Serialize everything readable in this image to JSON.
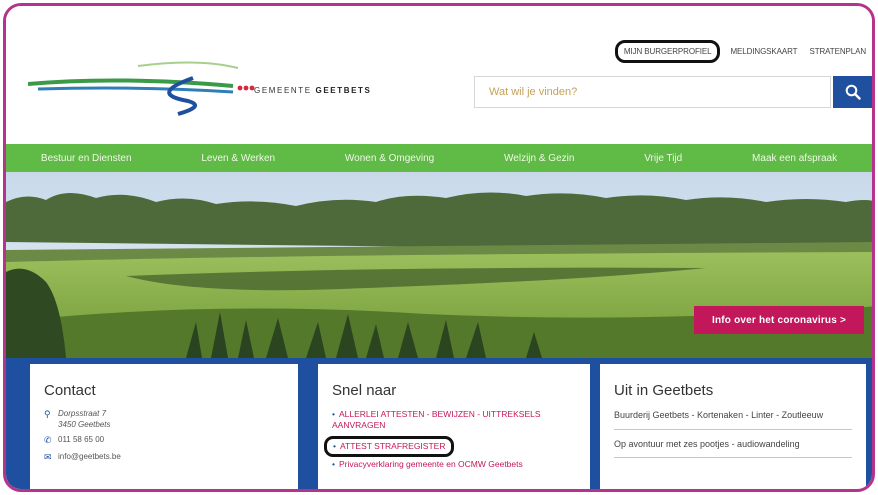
{
  "header": {
    "logo_text_a": "GEMEENTE",
    "logo_text_b": "GEETBETS",
    "toplinks": [
      {
        "label": "MIJN BURGERPROFIEL"
      },
      {
        "label": "MELDINGSKAART"
      },
      {
        "label": "STRATENPLAN"
      }
    ],
    "search": {
      "placeholder": "Wat wil je vinden?"
    }
  },
  "nav": {
    "items": [
      {
        "label": "Bestuur en Diensten"
      },
      {
        "label": "Leven & Werken"
      },
      {
        "label": "Wonen & Omgeving"
      },
      {
        "label": "Welzijn & Gezin"
      },
      {
        "label": "Vrije Tijd"
      },
      {
        "label": "Maak een afspraak"
      }
    ]
  },
  "hero": {
    "corona_label": "Info over het coronavirus >"
  },
  "contact": {
    "title": "Contact",
    "street": "Dorpsstraat 7",
    "city": "3450 Geetbets",
    "phone": "011 58 65 00",
    "email": "info@geetbets.be"
  },
  "quick": {
    "title": "Snel naar",
    "items": [
      {
        "label": "ALLERLEI ATTESTEN - BEWIJZEN - UITTREKSELS"
      },
      {
        "label": "AANVRAGEN"
      },
      {
        "label": "ATTEST STRAFREGISTER"
      },
      {
        "label": "Privacyverklaring gemeente en OCMW Geetbets"
      }
    ]
  },
  "uit": {
    "title": "Uit in Geetbets",
    "items": [
      {
        "label": "Buurderij Geetbets - Kortenaken - Linter - Zoutleeuw"
      },
      {
        "label": "Op avontuur met zes pootjes - audiowandeling"
      }
    ]
  },
  "colors": {
    "frame": "#b5338a",
    "nav_green": "#5fba46",
    "brand_blue": "#1f4f9f",
    "accent_magenta": "#c2185b"
  }
}
